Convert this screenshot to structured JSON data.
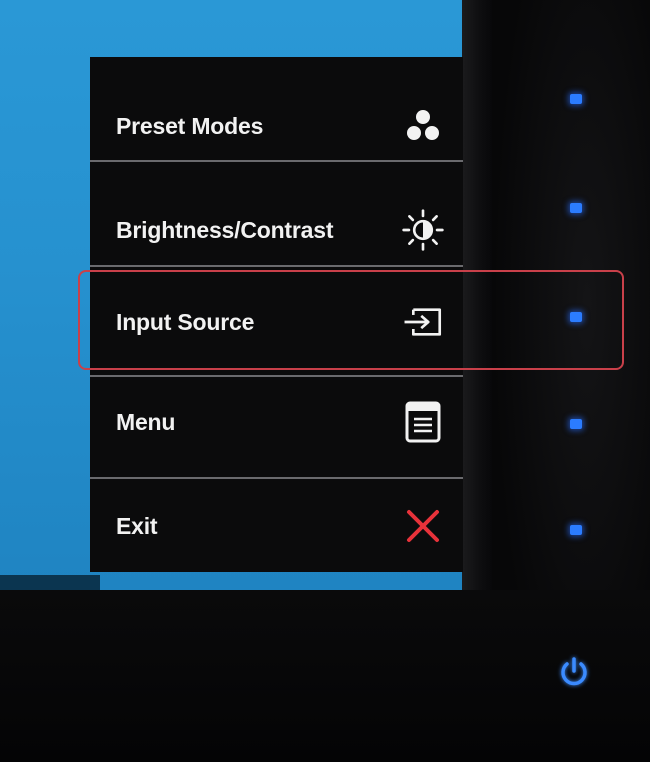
{
  "osd_menu": {
    "items": [
      {
        "label": "Preset Modes",
        "icon": "preset-modes-icon"
      },
      {
        "label": "Brightness/Contrast",
        "icon": "brightness-contrast-icon"
      },
      {
        "label": "Input Source",
        "icon": "input-source-icon",
        "highlighted": true
      },
      {
        "label": "Menu",
        "icon": "menu-icon"
      },
      {
        "label": "Exit",
        "icon": "exit-icon"
      }
    ]
  },
  "hardware_buttons": {
    "count": 5,
    "led_color": "#2b7cff",
    "power_icon": "power-icon"
  },
  "colors": {
    "screen": "#2691cf",
    "osd_background": "#0b0b0c",
    "highlight_border": "#c9404a",
    "exit_icon": "#e8323a"
  }
}
